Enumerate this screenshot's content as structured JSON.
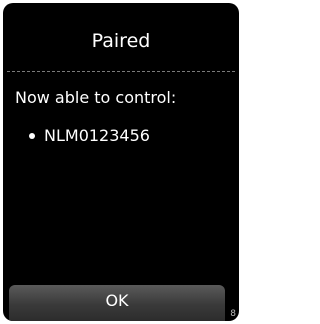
{
  "screen": {
    "title": "Paired",
    "subheading": "Now able to control:",
    "devices": [
      "NLM0123456"
    ],
    "ok_label": "OK",
    "page_number": "8"
  },
  "colors": {
    "background": "#000000",
    "text": "#ffffff",
    "button": "#3a3a3a",
    "separator": "#7a7a7a"
  },
  "icons": {
    "list_bullet": "bullet-icon"
  }
}
